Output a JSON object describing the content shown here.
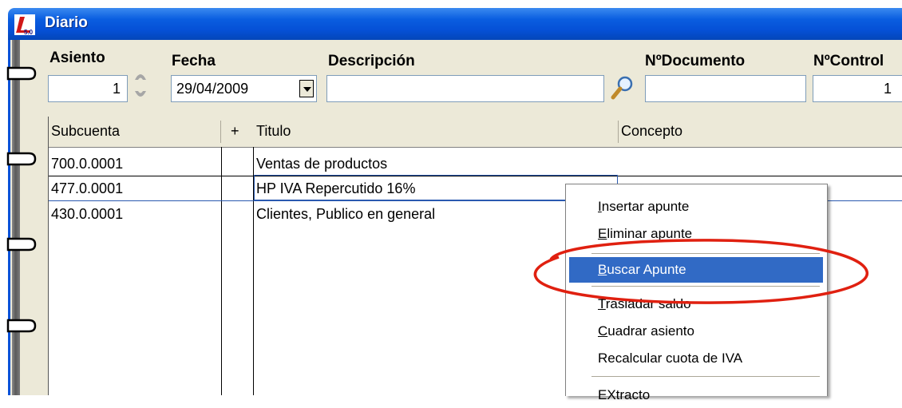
{
  "window": {
    "title": "Diario",
    "icon": "app-logo-icon",
    "titlebar_color": "#0a5ee0"
  },
  "header": {
    "asiento": {
      "label": "Asiento",
      "value": "1"
    },
    "fecha": {
      "label": "Fecha",
      "value": "29/04/2009"
    },
    "descripcion": {
      "label": "Descripción",
      "value": ""
    },
    "documento": {
      "label": "NºDocumento",
      "value": ""
    },
    "control": {
      "label": "NºControl",
      "value": "1"
    }
  },
  "grid": {
    "columns": [
      "Subcuenta",
      "+",
      "Titulo",
      "Concepto"
    ],
    "rows": [
      {
        "subcuenta": "700.0.0001",
        "plus": "",
        "titulo": "Ventas de productos",
        "concepto": ""
      },
      {
        "subcuenta": "477.0.0001",
        "plus": "",
        "titulo": "HP IVA Repercutido 16%",
        "concepto": ""
      },
      {
        "subcuenta": "430.0.0001",
        "plus": "",
        "titulo": "Clientes, Publico en general",
        "concepto": ""
      }
    ]
  },
  "context_menu": {
    "items": [
      {
        "key": "I",
        "rest": "nsertar apunte"
      },
      {
        "key": "E",
        "rest": "liminar apunte"
      },
      {
        "key": "B",
        "rest": "uscar Apunte",
        "highlighted": true
      },
      {
        "key": "T",
        "rest": "rasladar saldo"
      },
      {
        "key": "C",
        "rest": "uadrar asiento"
      },
      {
        "key": "",
        "rest": "Recalcular cuota de IVA"
      },
      {
        "key": "",
        "rest": "EXtracto"
      }
    ],
    "highlight_color": "#316ac5"
  },
  "annotation": {
    "color": "#e02010"
  }
}
